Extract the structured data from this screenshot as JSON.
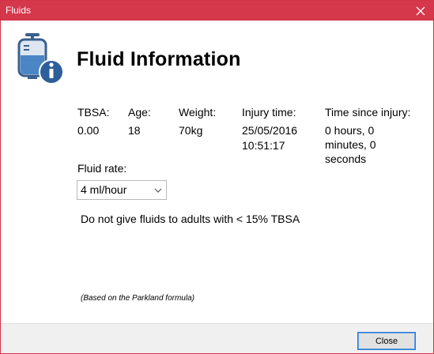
{
  "window": {
    "title": "Fluids",
    "accent_color": "#d5374b"
  },
  "header": {
    "title": "Fluid Information",
    "icon": "iv-bag-info-icon"
  },
  "fields": {
    "tbsa": {
      "label": "TBSA:",
      "value": "0.00"
    },
    "age": {
      "label": "Age:",
      "value": "18"
    },
    "weight": {
      "label": "Weight:",
      "value": "70kg"
    },
    "injury_time": {
      "label": "Injury time:",
      "value_date": "25/05/2016",
      "value_time": "10:51:17"
    },
    "time_since_injury": {
      "label": "Time since injury:",
      "value": "0 hours, 0 minutes, 0 seconds"
    }
  },
  "fluid_rate": {
    "label": "Fluid rate:",
    "selected": "4 ml/hour"
  },
  "warning": "Do not give fluids to adults with < 15% TBSA",
  "footnote": "(Based on the Parkland formula)",
  "footer": {
    "close_label": "Close"
  }
}
